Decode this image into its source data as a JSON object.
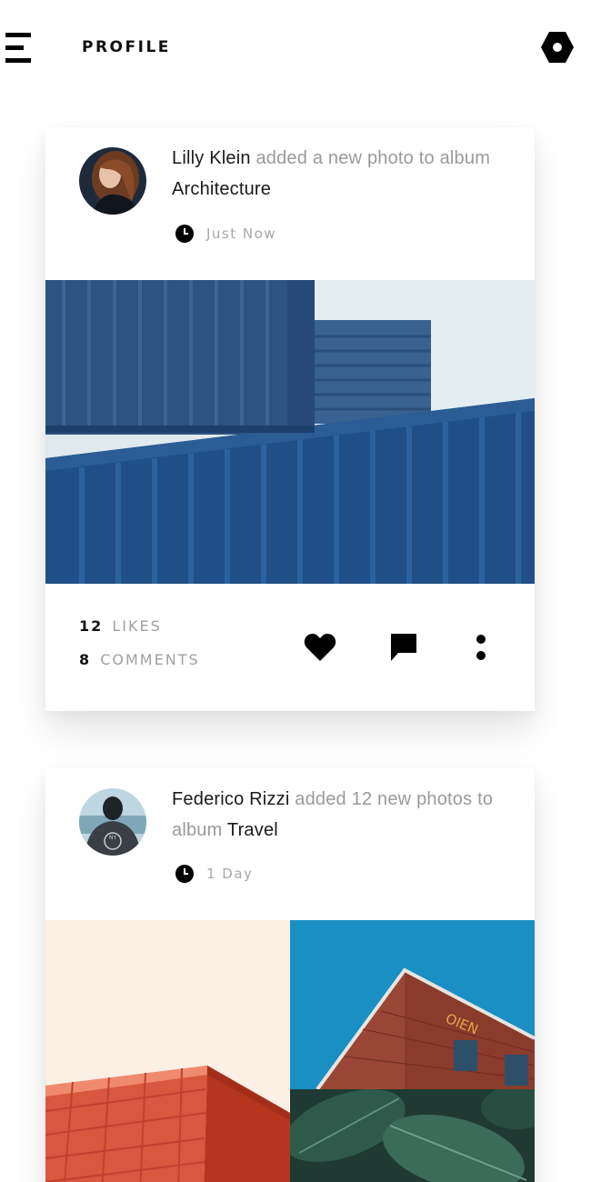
{
  "header": {
    "title": "PROFILE",
    "menu_icon": "hamburger-menu-icon",
    "settings_icon": "hexagon-settings-icon"
  },
  "feed": [
    {
      "author": "Lilly Klein",
      "action_text": "added a new photo to album",
      "album": "Architecture",
      "time": "Just Now",
      "likes_count": "12",
      "likes_label": "LIKES",
      "comments_count": "8",
      "comments_label": "COMMENTS",
      "photo_icon": "blue-shipping-containers-photo"
    },
    {
      "author": "Federico Rizzi",
      "action_text": "added 12 new photos to album",
      "album": "Travel",
      "time": "1 Day",
      "photo_icons": [
        "red-roof-photo",
        "brick-building-photo",
        "green-leaves-photo"
      ]
    }
  ],
  "icons": {
    "like": "heart-icon",
    "comment": "comment-bubble-icon",
    "more": "more-vertical-icon",
    "time": "clock-icon"
  },
  "colors": {
    "text_dark": "#1a1a1a",
    "text_muted": "#9a9a9a",
    "container_blue": "#1f4f86",
    "sky_blue": "#1a8fc3",
    "roof_red": "#d9563f"
  }
}
